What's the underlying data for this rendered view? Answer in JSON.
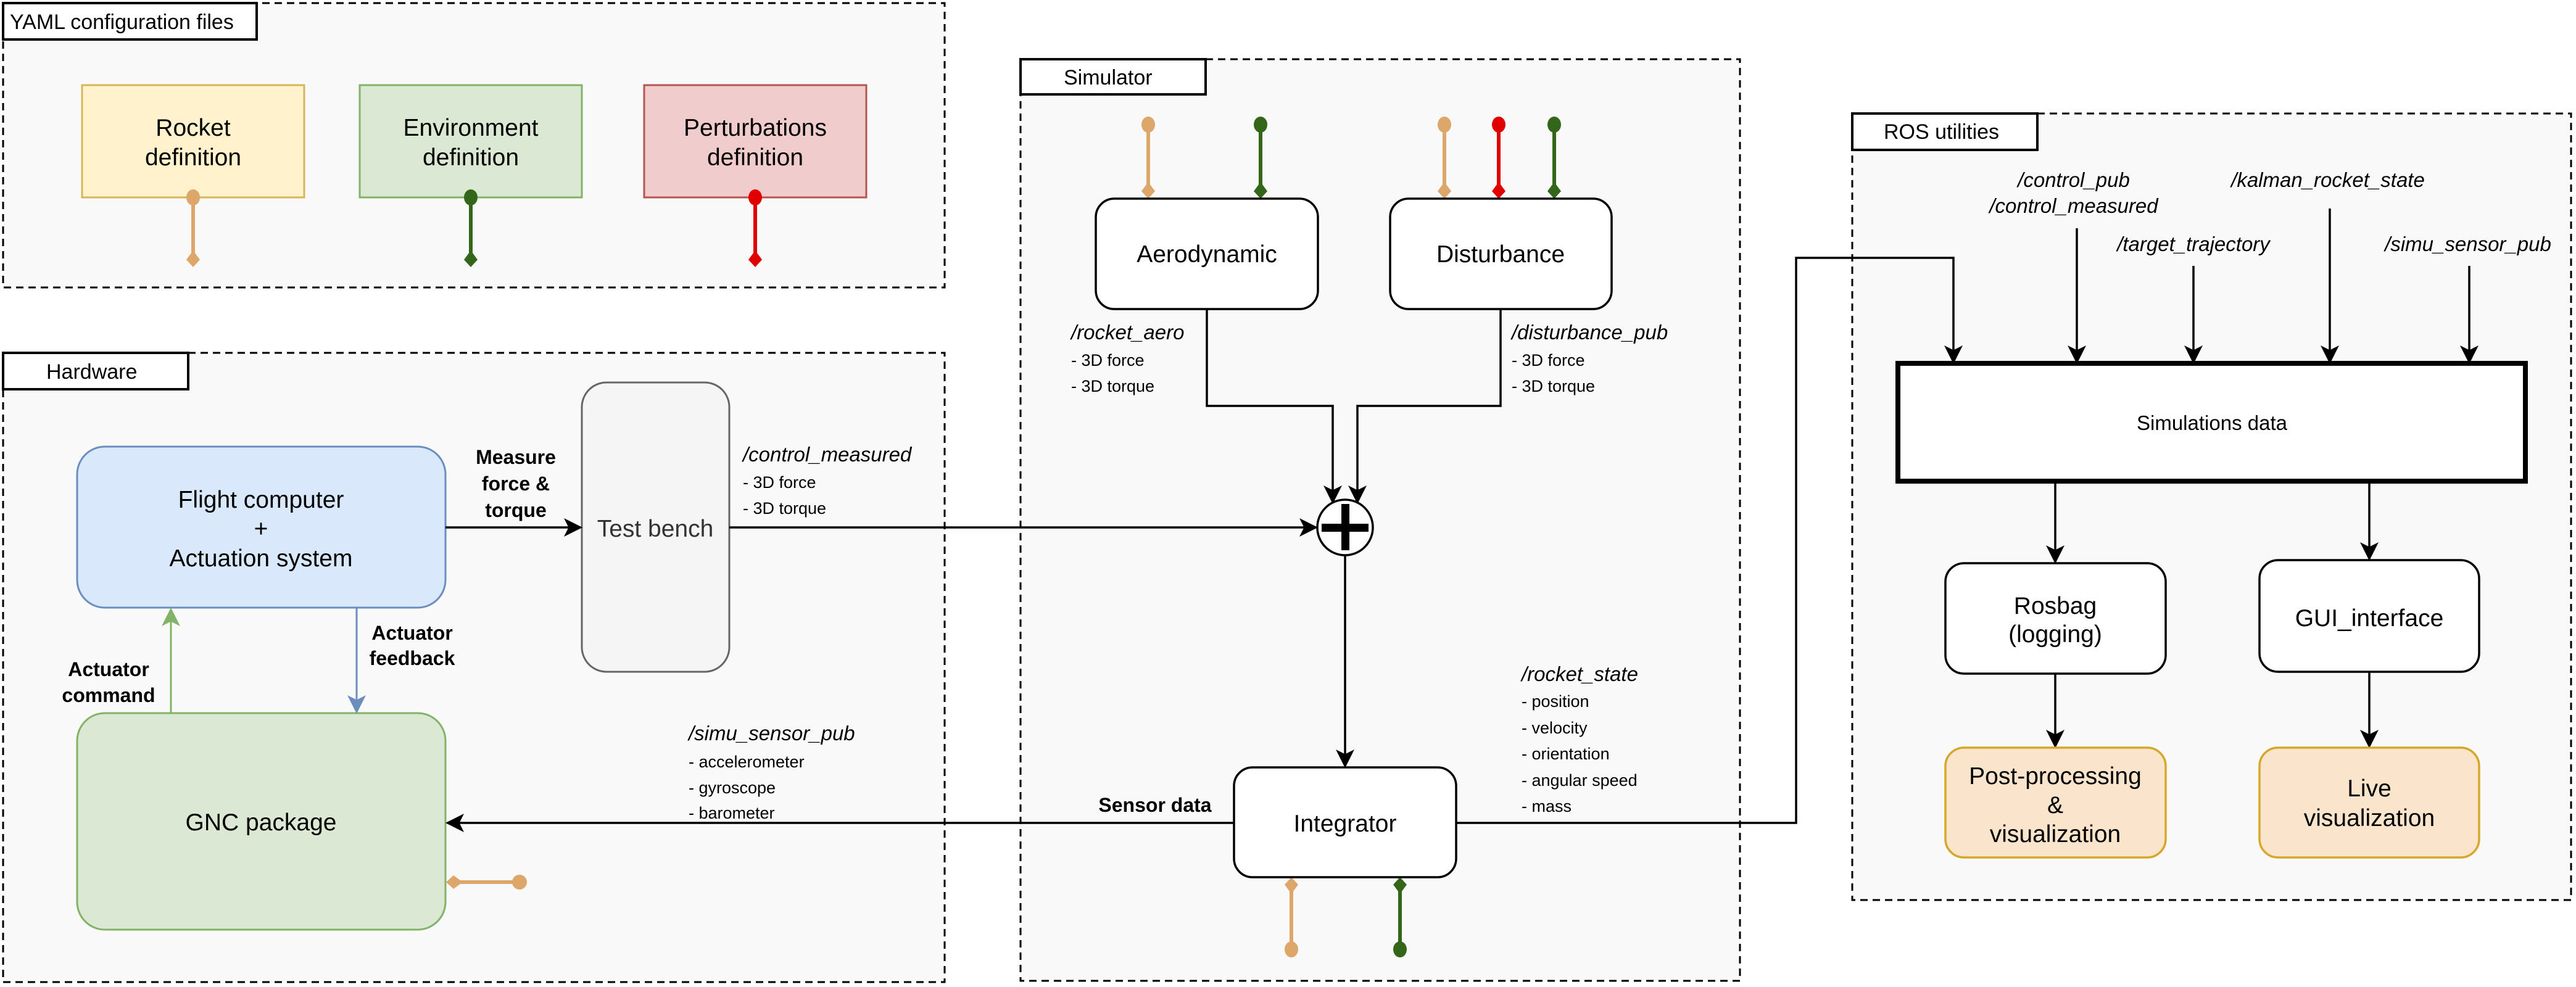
{
  "sections": {
    "yaml": {
      "title": "YAML configuration files"
    },
    "hardware": {
      "title": "Hardware"
    },
    "simulator": {
      "title": "Simulator"
    },
    "ros": {
      "title": "ROS utilities"
    }
  },
  "yaml_boxes": [
    {
      "line1": "Rocket",
      "line2": "definition",
      "fill": "#fff2cc",
      "stroke": "#d6b656",
      "port_color": "#dda66a"
    },
    {
      "line1": "Environment",
      "line2": "definition",
      "fill": "#dae8d4",
      "stroke": "#82b366",
      "port_color": "#336619"
    },
    {
      "line1": "Perturbations",
      "line2": "definition",
      "fill": "#f0cccc",
      "stroke": "#b85450",
      "port_color": "#e00000"
    }
  ],
  "port_colors": {
    "rocket": "#dda66a",
    "environment": "#336619",
    "perturbations": "#e00000"
  },
  "hardware": {
    "flight_computer": {
      "line1": "Flight computer",
      "line2": "+",
      "line3": "Actuation system",
      "fill": "#dae8fc",
      "stroke": "#6c8ebf"
    },
    "gnc": {
      "label": "GNC package",
      "fill": "#dae8d4",
      "stroke": "#82b366"
    },
    "test_bench": {
      "label": "Test bench",
      "fill": "#f5f5f5",
      "stroke": "#666666"
    },
    "measure_label": [
      "Measure",
      "force &",
      "torque"
    ],
    "actuator_command": [
      "Actuator",
      "command"
    ],
    "actuator_feedback": [
      "Actuator",
      "feedback"
    ],
    "control_measured": {
      "topic": "/control_measured",
      "items": [
        "- 3D force",
        "- 3D torque"
      ]
    },
    "simu_sensor_pub": {
      "topic": "/simu_sensor_pub",
      "items": [
        "- accelerometer",
        "- gyroscope",
        "- barometer"
      ]
    }
  },
  "simulator": {
    "aerodynamic": {
      "label": "Aerodynamic"
    },
    "disturbance": {
      "label": "Disturbance"
    },
    "integrator": {
      "label": "Integrator"
    },
    "rocket_aero": {
      "topic": "/rocket_aero",
      "items": [
        "- 3D force",
        "- 3D torque"
      ]
    },
    "disturbance_pub": {
      "topic": "/disturbance_pub",
      "items": [
        "- 3D force",
        "- 3D torque"
      ]
    },
    "rocket_state": {
      "topic": "/rocket_state",
      "items": [
        "- position",
        "- velocity",
        "- orientation",
        "- angular speed",
        "- mass"
      ]
    },
    "sensor_data_label": "Sensor data",
    "sum_symbol": "+"
  },
  "ros": {
    "topics": {
      "control_pub": "/control_pub",
      "control_measured": "/control_measured",
      "kalman_rocket_state": "/kalman_rocket_state",
      "target_trajectory": "/target_trajectory",
      "simu_sensor_pub": "/simu_sensor_pub"
    },
    "simulations_data": {
      "label": "Simulations data"
    },
    "rosbag": {
      "line1": "Rosbag",
      "line2": "(logging)"
    },
    "gui": {
      "label": "GUI_interface"
    },
    "post_processing": {
      "line1": "Post-processing",
      "line2": "&",
      "line3": "visualization",
      "fill": "#fae5cc",
      "stroke": "#d6a72a"
    },
    "live_visualization": {
      "line1": "Live",
      "line2": "visualization",
      "fill": "#fae5cc",
      "stroke": "#d6a72a"
    }
  }
}
